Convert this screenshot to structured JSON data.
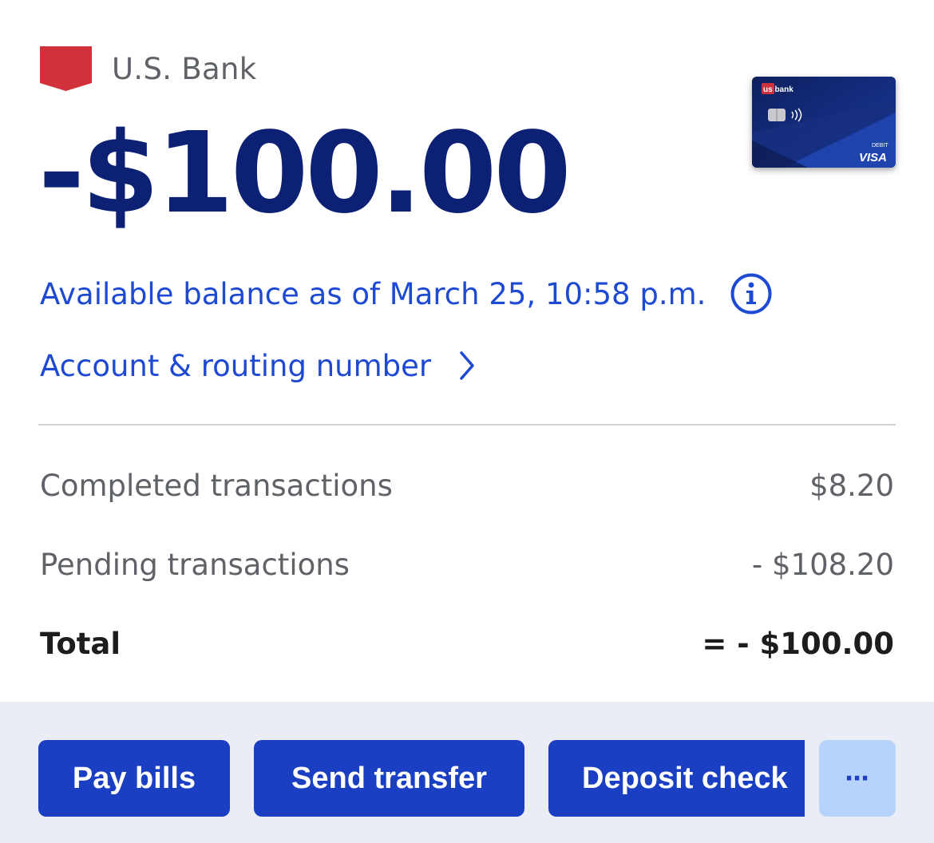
{
  "header": {
    "bank_name": "U.S. Bank",
    "logo_icon": "bank-flag-icon"
  },
  "balance": {
    "amount": "-$100.00"
  },
  "card": {
    "brand": "us bank",
    "type_label": "DEBIT",
    "network": "VISA"
  },
  "available": {
    "text": "Available balance as of March 25, 10:58 p.m.",
    "icon": "info-icon"
  },
  "account_link": {
    "text": "Account & routing number",
    "icon": "chevron-right-icon"
  },
  "summary": {
    "completed_label": "Completed transactions",
    "completed_value": "$8.20",
    "pending_label": "Pending transactions",
    "pending_value": "- $108.20",
    "total_label": "Total",
    "total_value": "= - $100.00"
  },
  "actions": {
    "pay_bills": "Pay bills",
    "send_transfer": "Send transfer",
    "deposit_check": "Deposit check",
    "more": "⋯"
  },
  "colors": {
    "brand_red": "#d0313b",
    "balance_navy": "#0c2074",
    "link_blue": "#1e4ad3",
    "button_blue": "#1b3fc2",
    "more_button_bg": "#b8d3fb",
    "action_bar_bg": "#eaedf5"
  }
}
